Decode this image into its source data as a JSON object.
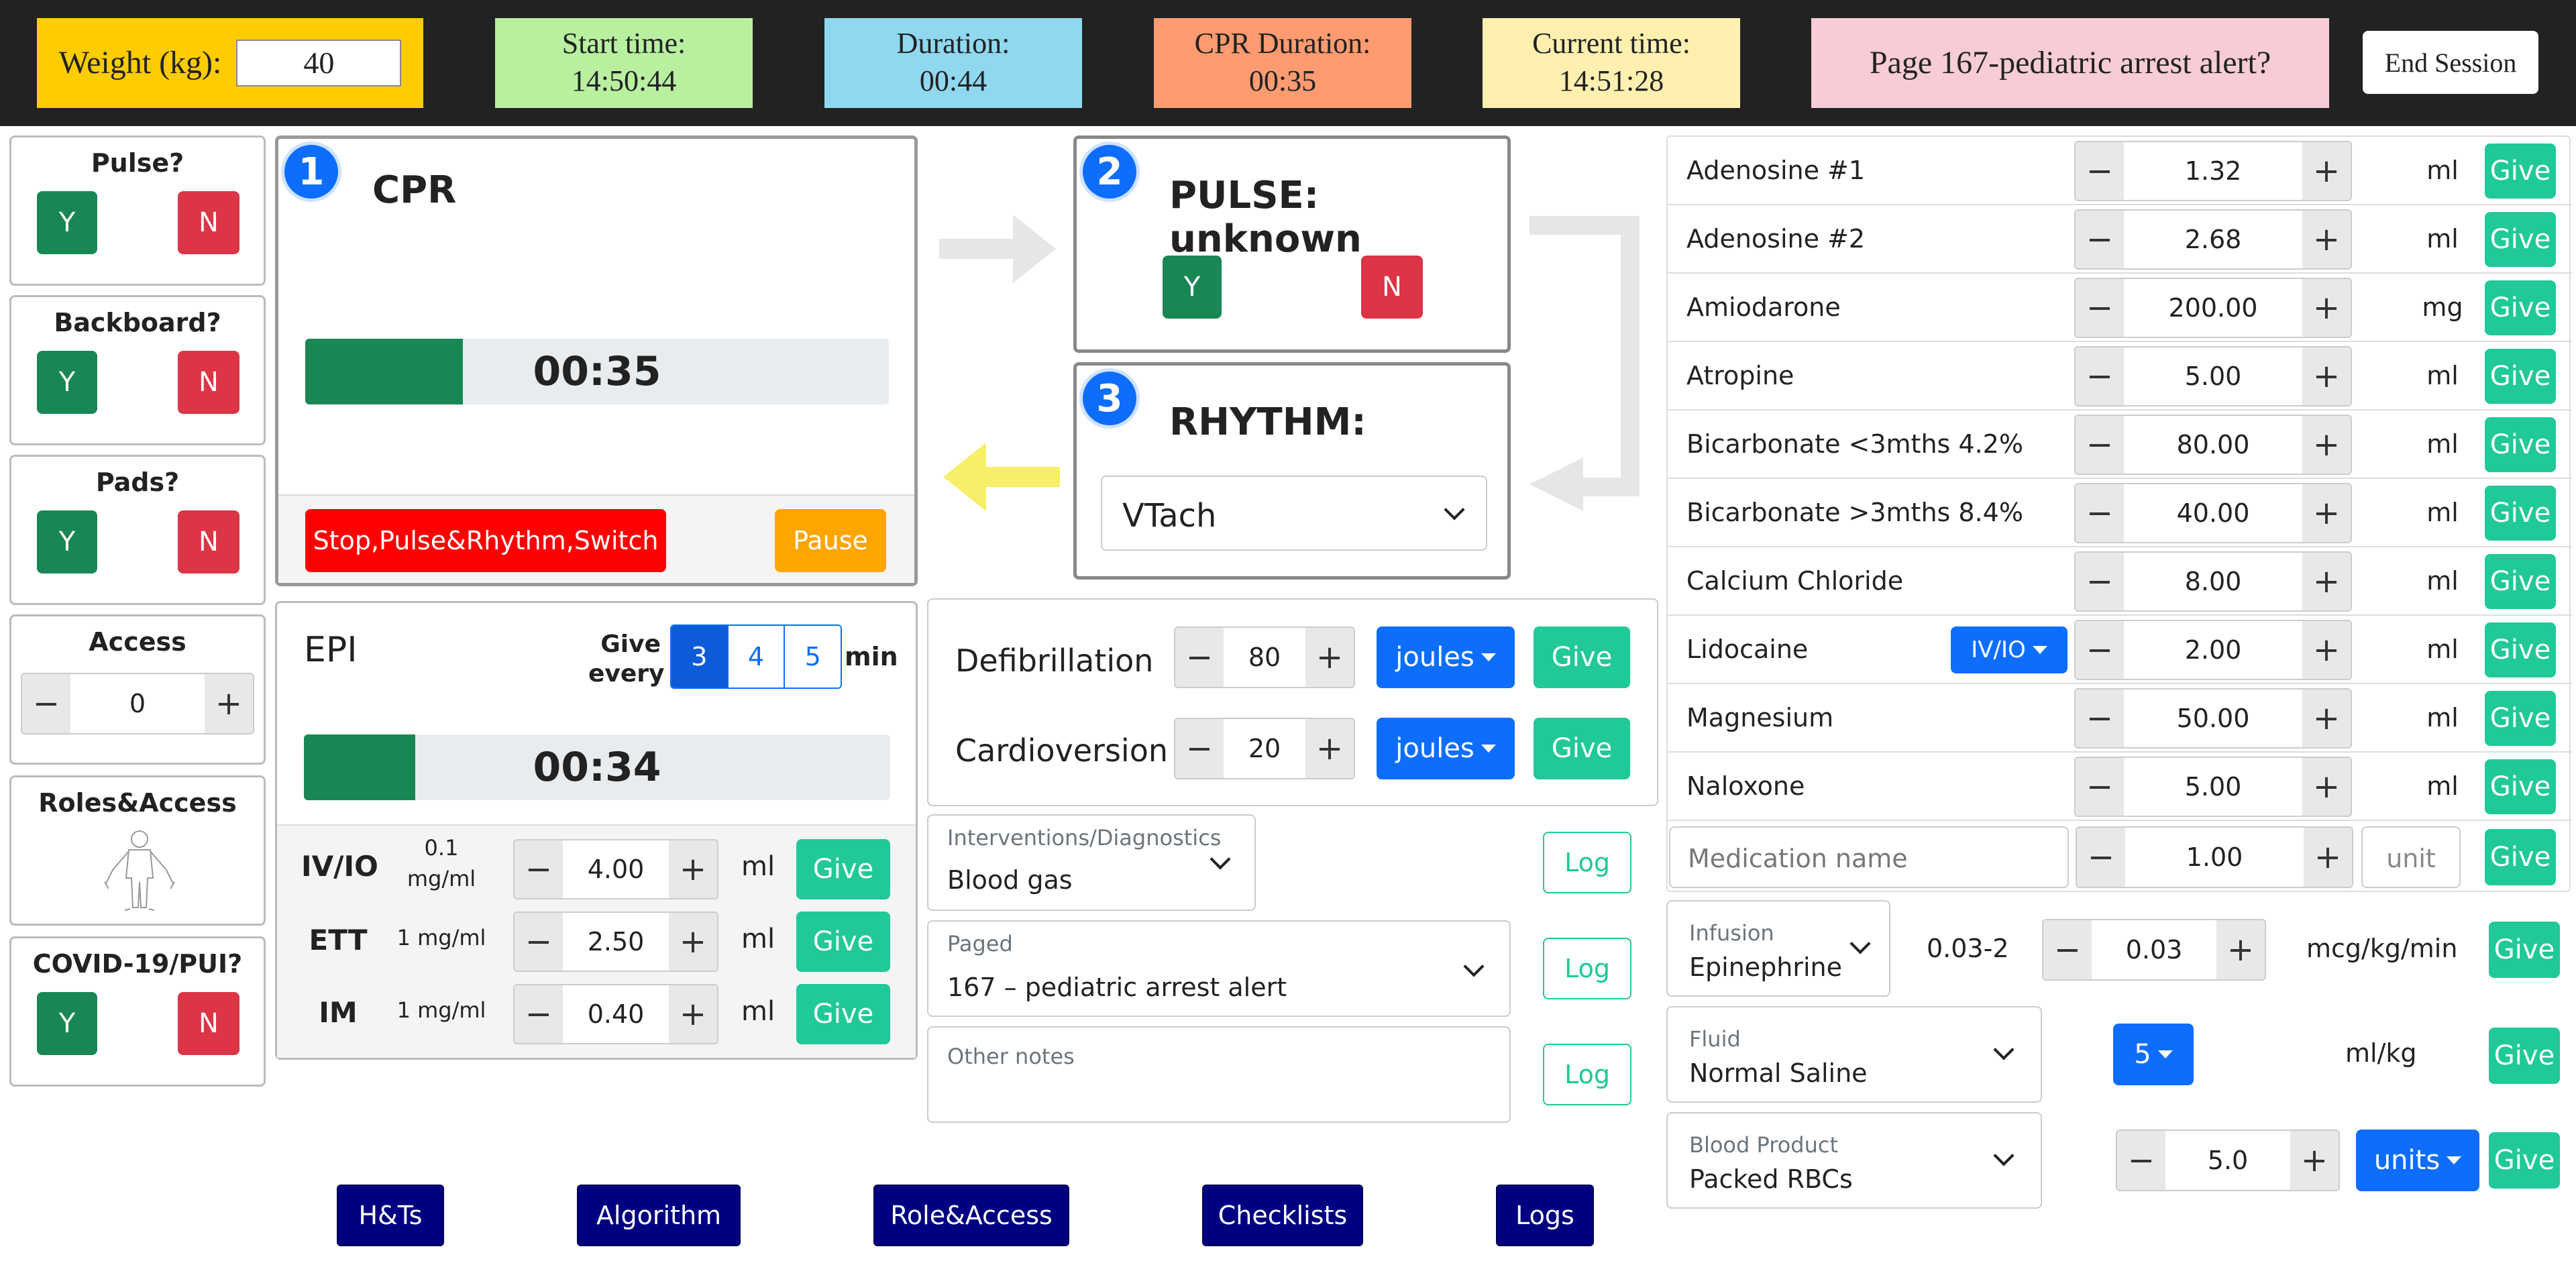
{
  "header": {
    "weight_label": "Weight (kg):",
    "weight_value": "40",
    "start_label": "Start time:",
    "start_value": "14:50:44",
    "duration_label": "Duration:",
    "duration_value": "00:44",
    "cpr_label": "CPR Duration:",
    "cpr_value": "00:35",
    "current_label": "Current time:",
    "current_value": "14:51:28",
    "alert": "Page 167-pediatric arrest alert?",
    "end_session": "End Session"
  },
  "left": {
    "pulse": {
      "title": "Pulse?",
      "y": "Y",
      "n": "N"
    },
    "backboard": {
      "title": "Backboard?",
      "y": "Y",
      "n": "N"
    },
    "pads": {
      "title": "Pads?",
      "y": "Y",
      "n": "N"
    },
    "access": {
      "title": "Access",
      "minus": "−",
      "value": "0",
      "plus": "+"
    },
    "roles": {
      "title": "Roles&Access"
    },
    "covid": {
      "title": "COVID-19/PUI?",
      "y": "Y",
      "n": "N"
    }
  },
  "cpr": {
    "step": "1",
    "title": "CPR",
    "timer": "00:35",
    "progress": 0.27,
    "stop_label": "Stop,Pulse&Rhythm,Switch",
    "pause_label": "Pause"
  },
  "pulse_panel": {
    "step": "2",
    "title": "PULSE: unknown",
    "y": "Y",
    "n": "N"
  },
  "rhythm_panel": {
    "step": "3",
    "title": "RHYTHM:",
    "selected": "VTach"
  },
  "epi": {
    "title": "EPI",
    "give_every_1": "Give",
    "give_every_2": "every",
    "intervals": [
      "3",
      "4",
      "5"
    ],
    "selected_interval": "3",
    "min_label": "min",
    "timer": "00:34",
    "progress": 0.19,
    "rows": [
      {
        "route": "IV/IO",
        "conc1": "0.1",
        "conc2": "mg/ml",
        "value": "4.00",
        "unit": "ml",
        "give": "Give"
      },
      {
        "route": "ETT",
        "conc1": "1 mg/ml",
        "conc2": "",
        "value": "2.50",
        "unit": "ml",
        "give": "Give"
      },
      {
        "route": "IM",
        "conc1": "1 mg/ml",
        "conc2": "",
        "value": "0.40",
        "unit": "ml",
        "give": "Give"
      }
    ]
  },
  "defib": {
    "rows": [
      {
        "label": "Defibrillation",
        "value": "80",
        "unit": "joules",
        "give": "Give"
      },
      {
        "label": "Cardioversion",
        "value": "20",
        "unit": "joules",
        "give": "Give"
      }
    ]
  },
  "interventions": {
    "label": "Interventions/Diagnostics",
    "value": "Blood gas",
    "log": "Log"
  },
  "paged": {
    "label": "Paged",
    "value": "167 – pediatric arrest alert",
    "log": "Log"
  },
  "notes": {
    "placeholder": "Other notes",
    "log": "Log"
  },
  "meds": [
    {
      "name": "Adenosine #1",
      "value": "1.32",
      "unit": "ml",
      "give": "Give"
    },
    {
      "name": "Adenosine #2",
      "value": "2.68",
      "unit": "ml",
      "give": "Give"
    },
    {
      "name": "Amiodarone",
      "value": "200.00",
      "unit": "mg",
      "give": "Give"
    },
    {
      "name": "Atropine",
      "value": "5.00",
      "unit": "ml",
      "give": "Give"
    },
    {
      "name": "Bicarbonate <3mths 4.2%",
      "value": "80.00",
      "unit": "ml",
      "give": "Give"
    },
    {
      "name": "Bicarbonate >3mths 8.4%",
      "value": "40.00",
      "unit": "ml",
      "give": "Give"
    },
    {
      "name": "Calcium Chloride",
      "value": "8.00",
      "unit": "ml",
      "give": "Give"
    },
    {
      "name": "Lidocaine",
      "value": "2.00",
      "unit": "ml",
      "give": "Give",
      "route": "IV/IO"
    },
    {
      "name": "Magnesium",
      "value": "50.00",
      "unit": "ml",
      "give": "Give"
    },
    {
      "name": "Naloxone",
      "value": "5.00",
      "unit": "ml",
      "give": "Give"
    }
  ],
  "custom_med": {
    "name_placeholder": "Medication name",
    "value": "1.00",
    "unit_placeholder": "unit",
    "give": "Give"
  },
  "infusion": {
    "label": "Infusion",
    "value": "Epinephrine",
    "range": "0.03-2",
    "dose": "0.03",
    "unit": "mcg/kg/min",
    "give": "Give"
  },
  "fluid": {
    "label": "Fluid",
    "value": "Normal Saline",
    "amount": "5",
    "unit": "ml/kg",
    "give": "Give"
  },
  "blood": {
    "label": "Blood Product",
    "value": "Packed RBCs",
    "dose": "5.0",
    "unit": "units",
    "give": "Give"
  },
  "nav": [
    "H&Ts",
    "Algorithm",
    "Role&Access",
    "Checklists",
    "Logs"
  ],
  "colors": {
    "weight_bg": "#ffcc00",
    "start_bg": "#b8f0a0",
    "duration_bg": "#8fd8ef",
    "cpr_bg": "#ff9b70",
    "current_bg": "#fff0b0",
    "alert_bg": "#f7ccd6",
    "green": "#198754",
    "red": "#dc3545",
    "teal": "#20c997",
    "blue": "#0d6efd",
    "navy": "#000080"
  }
}
